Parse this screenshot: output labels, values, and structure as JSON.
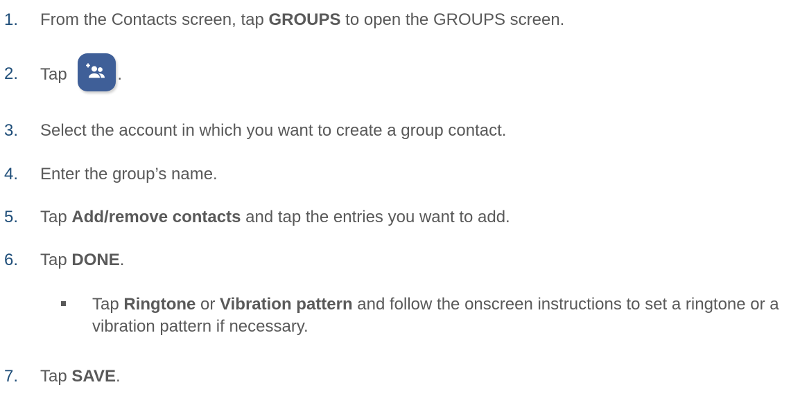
{
  "steps": [
    {
      "num": "1.",
      "pre": "From the Contacts screen, tap ",
      "bold": "GROUPS",
      "post": " to open the GROUPS screen."
    },
    {
      "num": "2.",
      "pre": "Tap ",
      "icon": "add-group-icon",
      "post": "."
    },
    {
      "num": "3.",
      "text": "Select the account in which you want to create a group contact."
    },
    {
      "num": "4.",
      "text": "Enter the group’s name."
    },
    {
      "num": "5.",
      "pre": "Tap ",
      "bold": "Add/remove contacts",
      "post": " and tap the entries you want to add."
    },
    {
      "num": "6.",
      "pre": "Tap ",
      "bold": "DONE",
      "post": "."
    },
    {
      "num": "7.",
      "pre": "Tap ",
      "bold": "SAVE",
      "post": "."
    }
  ],
  "sub_bullet": {
    "pre": "Tap ",
    "bold1": "Ringtone",
    "mid": " or ",
    "bold2": "Vibration pattern",
    "post": " and follow the onscreen instructions to set a ringtone or a vibration pattern if necessary."
  },
  "colors": {
    "step_number": "#1f4e79",
    "body_text": "#595959",
    "icon_tile": "#3f5f98"
  }
}
